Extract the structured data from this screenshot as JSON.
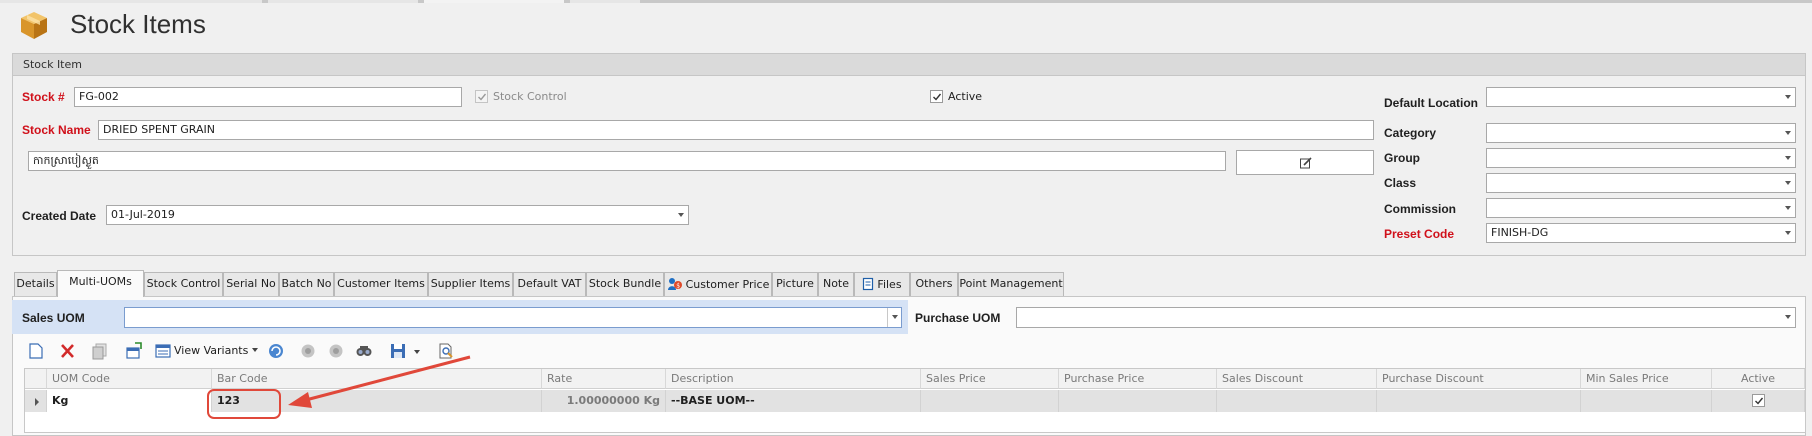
{
  "page": {
    "title": "Stock Items"
  },
  "group": {
    "caption": "Stock Item"
  },
  "form": {
    "stock_no": {
      "label": "Stock #",
      "value": "FG-002"
    },
    "stock_control": {
      "label": "Stock Control",
      "checked": true,
      "disabled": true
    },
    "active": {
      "label": "Active",
      "checked": true
    },
    "stock_name": {
      "label": "Stock Name",
      "value": "DRIED SPENT GRAIN"
    },
    "stock_name_alt": {
      "value": "កាកស្រាបៀស្ងួត"
    },
    "created_date": {
      "label": "Created Date",
      "value": "01-Jul-2019"
    },
    "default_location": {
      "label": "Default Location",
      "value": ""
    },
    "category": {
      "label": "Category",
      "value": ""
    },
    "group_field": {
      "label": "Group",
      "value": ""
    },
    "class_field": {
      "label": "Class",
      "value": ""
    },
    "commission": {
      "label": "Commission",
      "value": ""
    },
    "preset_code": {
      "label": "Preset Code",
      "value": "FINISH-DG"
    }
  },
  "tabs": [
    {
      "label": "Details"
    },
    {
      "label": "Multi-UOMs",
      "active": true
    },
    {
      "label": "Stock Control"
    },
    {
      "label": "Serial No"
    },
    {
      "label": "Batch No"
    },
    {
      "label": "Customer Items"
    },
    {
      "label": "Supplier Items"
    },
    {
      "label": "Default VAT"
    },
    {
      "label": "Stock Bundle"
    },
    {
      "label": "Customer Price",
      "icon": "customer-price-icon"
    },
    {
      "label": "Picture"
    },
    {
      "label": "Note"
    },
    {
      "label": "Files",
      "icon": "files-icon"
    },
    {
      "label": "Others"
    },
    {
      "label": "Point Management"
    }
  ],
  "uom": {
    "sales_label": "Sales UOM",
    "sales_value": "",
    "purchase_label": "Purchase UOM",
    "purchase_value": ""
  },
  "toolbar": {
    "view_variants": "View Variants",
    "icons": [
      "new-row-icon",
      "delete-icon",
      "copy-icon",
      "new-window-icon",
      "view-variants-icon",
      "refresh-icon",
      "move-prev-icon",
      "move-next-icon",
      "find-icon",
      "save-icon",
      "save-dropdown-icon",
      "preview-icon"
    ]
  },
  "grid": {
    "columns": [
      "UOM Code",
      "Bar Code",
      "Rate",
      "Description",
      "Sales Price",
      "Purchase Price",
      "Sales Discount",
      "Purchase Discount",
      "Min Sales Price",
      "Active"
    ],
    "rows": [
      {
        "uom_code": "Kg",
        "bar_code": "123",
        "rate": "1.00000000 Kg",
        "description": "--BASE UOM--",
        "sales_price": "",
        "purchase_price": "",
        "sales_discount": "",
        "purchase_discount": "",
        "min_sales_price": "",
        "active": true
      }
    ]
  },
  "colors": {
    "required": "#d0101a",
    "callout": "#e0483a",
    "uom_bar": "#d5e2f5"
  }
}
